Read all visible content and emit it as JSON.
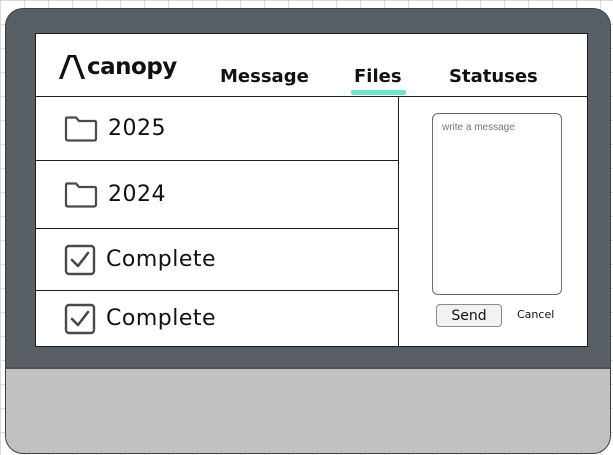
{
  "app": {
    "logo_text": "canopy"
  },
  "nav": {
    "tabs": [
      {
        "label": "Message"
      },
      {
        "label": "Files",
        "active": true
      },
      {
        "label": "Statuses"
      }
    ],
    "active_underline_color": "#6fe4cc"
  },
  "files": [
    {
      "label": "2025",
      "icon": "folder-icon"
    },
    {
      "label": "2024",
      "icon": "folder-icon"
    },
    {
      "label": "Complete",
      "icon": "checkbox-checked-icon"
    },
    {
      "label": "Complete",
      "icon": "checkbox-checked-icon"
    }
  ],
  "message": {
    "placeholder": "write a message",
    "send_label": "Send",
    "cancel_label": "Cancel"
  },
  "colors": {
    "device_frame": "#585f65",
    "device_chin": "#c1c2bf",
    "accent": "#6fe4cc"
  }
}
